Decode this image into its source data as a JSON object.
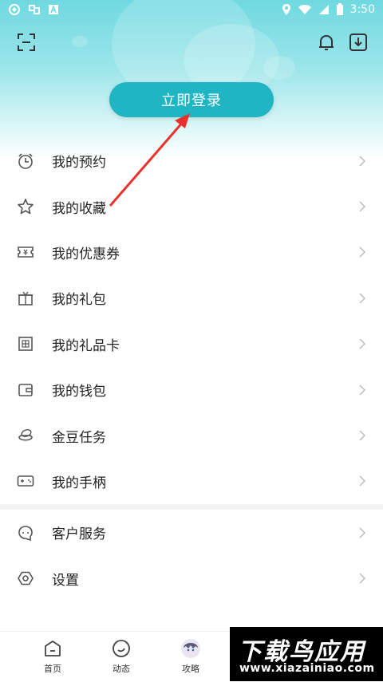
{
  "status_bar": {
    "time": "3:50"
  },
  "login_button": "立即登录",
  "menu": [
    {
      "label": "我的预约",
      "icon": "alarm-clock-icon"
    },
    {
      "label": "我的收藏",
      "icon": "star-icon"
    },
    {
      "label": "我的优惠券",
      "icon": "coupon-icon"
    },
    {
      "label": "我的礼包",
      "icon": "gift-box-icon"
    },
    {
      "label": "我的礼品卡",
      "icon": "gift-card-icon"
    },
    {
      "label": "我的钱包",
      "icon": "wallet-icon"
    },
    {
      "label": "金豆任务",
      "icon": "gold-bean-icon"
    },
    {
      "label": "我的手柄",
      "icon": "gamepad-icon"
    }
  ],
  "menu2": [
    {
      "label": "客户服务",
      "icon": "customer-service-icon"
    },
    {
      "label": "设置",
      "icon": "settings-icon"
    }
  ],
  "tabs": [
    {
      "label": "首页",
      "icon": "home-icon"
    },
    {
      "label": "动态",
      "icon": "moments-icon"
    },
    {
      "label": "攻略",
      "icon": "avatar-icon"
    }
  ],
  "watermark": {
    "title": "下载鸟应用",
    "url": "www.xiazainiao.com"
  },
  "colors": {
    "accent": "#1fb5c3",
    "hero_top": "#6fd9e0",
    "arrow": "#e8322b"
  }
}
